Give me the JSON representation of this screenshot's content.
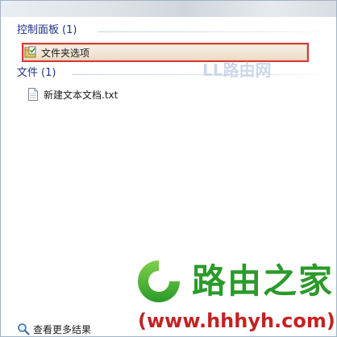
{
  "groups": [
    {
      "title": "控制面板",
      "count": "(1)",
      "items": [
        {
          "label": "文件夹选项",
          "icon": "folder-options-icon",
          "selected": true
        }
      ]
    },
    {
      "title": "文件",
      "count": "(1)",
      "items": [
        {
          "label": "新建文本文档.txt",
          "icon": "text-document-icon",
          "selected": false
        }
      ]
    }
  ],
  "footer": {
    "see_more_label": "查看更多结果",
    "icon": "search-icon"
  },
  "watermark": {
    "brand": "路由之家",
    "url": "(www.hhhyh.com)",
    "faded": "LL路由网"
  },
  "colors": {
    "group_header": "#1e3287",
    "selection_outline": "#d63a3a",
    "brand_green": "#2a9a2a",
    "url_red": "#c42222"
  }
}
